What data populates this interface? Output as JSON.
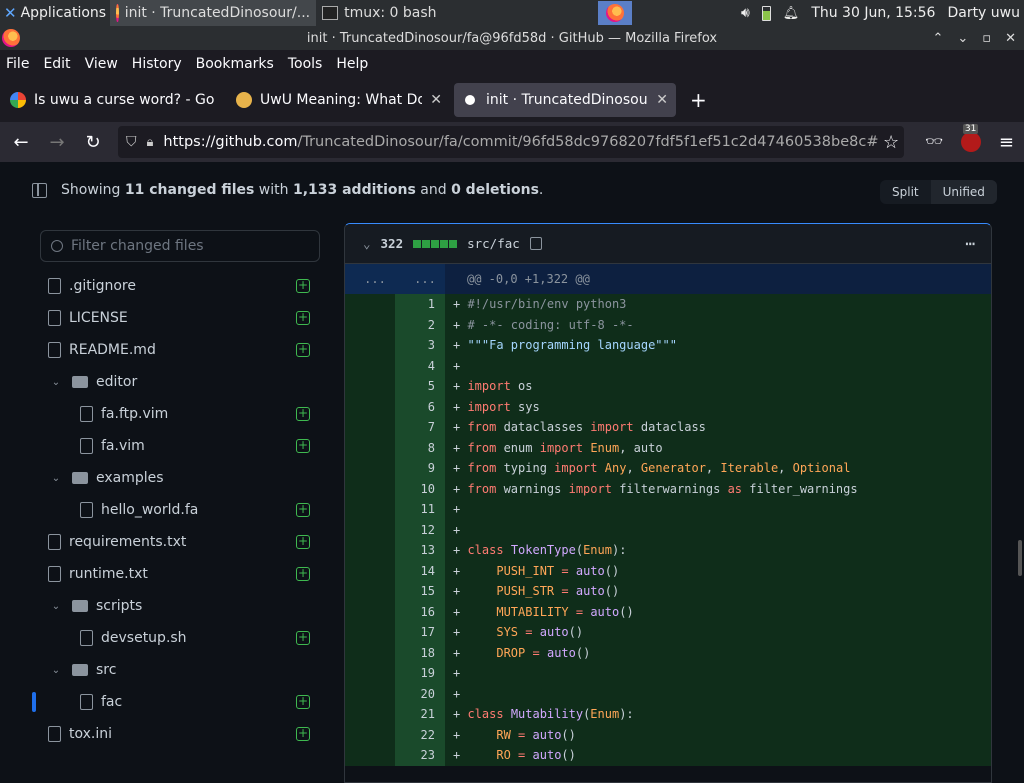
{
  "panel": {
    "applications": "Applications",
    "tasks": [
      "init · TruncatedDinosour/...",
      "tmux: 0 bash"
    ],
    "clock": "Thu 30 Jun, 15:56",
    "user": "Darty uwu"
  },
  "window": {
    "title": "init · TruncatedDinosour/fa@96fd58d · GitHub — Mozilla Firefox"
  },
  "menu": [
    "File",
    "Edit",
    "View",
    "History",
    "Bookmarks",
    "Tools",
    "Help"
  ],
  "tabs": [
    {
      "label": "Is uwu a curse word? - Go",
      "favicon_color": "#4285f4"
    },
    {
      "label": "UwU Meaning: What Doe",
      "favicon_color": "#e7b34b"
    },
    {
      "label": "init · TruncatedDinosour/",
      "favicon_color": "#ffffff"
    }
  ],
  "url": {
    "host": "https://github.com",
    "path": "/TruncatedDinosour/fa/commit/96fd58dc9768207fdf5f1ef51c2d47460538be8c#"
  },
  "extension_badge": "31",
  "summary": {
    "prefix": "Showing",
    "files": "11 changed files",
    "mid": "with",
    "additions": "1,133 additions",
    "and": "and",
    "deletions": "0 deletions",
    "end": "."
  },
  "view": {
    "split": "Split",
    "unified": "Unified"
  },
  "filter_placeholder": "Filter changed files",
  "tree": [
    {
      "name": ".gitignore",
      "type": "file",
      "depth": 0
    },
    {
      "name": "LICENSE",
      "type": "file",
      "depth": 0
    },
    {
      "name": "README.md",
      "type": "file",
      "depth": 0
    },
    {
      "name": "editor",
      "type": "dir",
      "depth": 0
    },
    {
      "name": "fa.ftp.vim",
      "type": "file",
      "depth": 1
    },
    {
      "name": "fa.vim",
      "type": "file",
      "depth": 1
    },
    {
      "name": "examples",
      "type": "dir",
      "depth": 0
    },
    {
      "name": "hello_world.fa",
      "type": "file",
      "depth": 1
    },
    {
      "name": "requirements.txt",
      "type": "file",
      "depth": 0
    },
    {
      "name": "runtime.txt",
      "type": "file",
      "depth": 0
    },
    {
      "name": "scripts",
      "type": "dir",
      "depth": 0
    },
    {
      "name": "devsetup.sh",
      "type": "file",
      "depth": 1
    },
    {
      "name": "src",
      "type": "dir",
      "depth": 0
    },
    {
      "name": "fac",
      "type": "file",
      "depth": 1,
      "selected": true
    },
    {
      "name": "tox.ini",
      "type": "file",
      "depth": 0
    }
  ],
  "diff": {
    "count": "322",
    "path": "src/fac",
    "hunk_left": "...",
    "hunk_right": "...",
    "hunk": "@@ -0,0 +1,322 @@",
    "lines": [
      "#!/usr/bin/env python3",
      "# -*- coding: utf-8 -*-",
      "\"\"\"Fa programming language\"\"\"",
      "",
      "import os",
      "import sys",
      "from dataclasses import dataclass",
      "from enum import Enum, auto",
      "from typing import Any, Generator, Iterable, Optional",
      "from warnings import filterwarnings as filter_warnings",
      "",
      "",
      "class TokenType(Enum):",
      "    PUSH_INT = auto()",
      "    PUSH_STR = auto()",
      "    MUTABILITY = auto()",
      "    SYS = auto()",
      "    DROP = auto()",
      "",
      "",
      "class Mutability(Enum):",
      "    RW = auto()",
      "    RO = auto()"
    ]
  }
}
